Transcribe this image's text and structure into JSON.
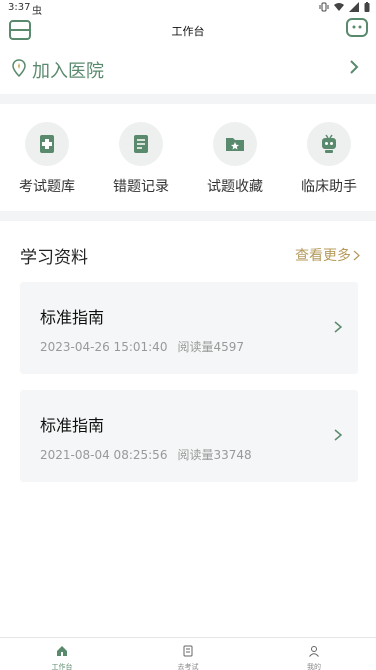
{
  "status_bar": {
    "time": "3:37",
    "app_glyph": "虫"
  },
  "header": {
    "title": "工作台"
  },
  "hospital": {
    "label": "加入医院"
  },
  "quick_actions": [
    {
      "label": "考试题库",
      "icon": "exam-bank-icon"
    },
    {
      "label": "错题记录",
      "icon": "wrong-questions-icon"
    },
    {
      "label": "试题收藏",
      "icon": "favorites-folder-icon"
    },
    {
      "label": "临床助手",
      "icon": "robot-assistant-icon"
    }
  ],
  "materials": {
    "title": "学习资料",
    "more_label": "查看更多",
    "items": [
      {
        "title": "标准指南",
        "date": "2023-04-26 15:01:40",
        "reads": "阅读量4597"
      },
      {
        "title": "标准指南",
        "date": "2021-08-04 08:25:56",
        "reads": "阅读量33748"
      }
    ]
  },
  "tabbar": {
    "tabs": [
      {
        "label": "工作台"
      },
      {
        "label": "去考试"
      },
      {
        "label": "我的"
      }
    ]
  },
  "colors": {
    "accent": "#5a8a6d",
    "more": "#b59a5b",
    "card_bg": "#f5f6f7",
    "section_bg": "#f3f4f6"
  }
}
